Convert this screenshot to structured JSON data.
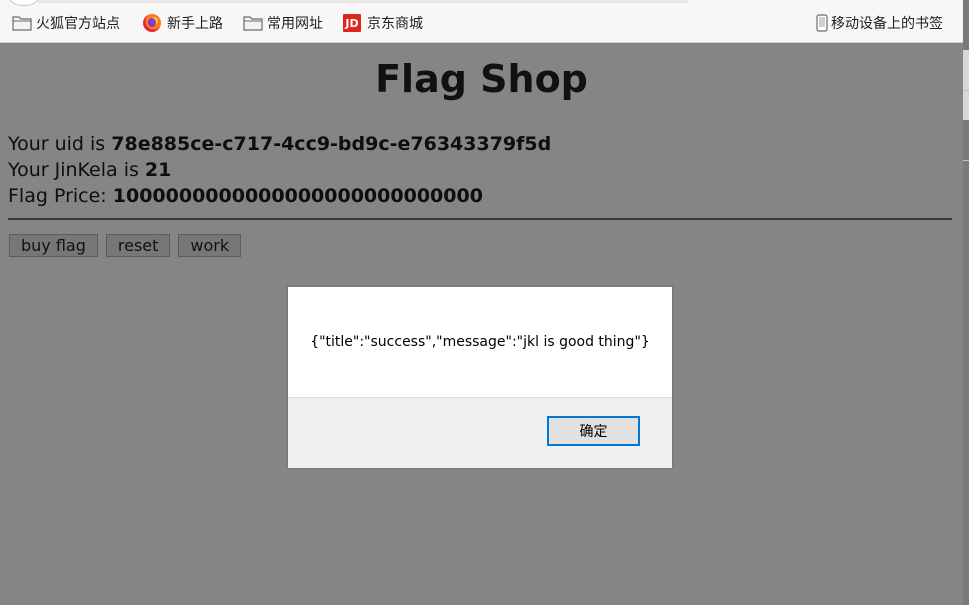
{
  "bookmarks": [
    {
      "label": "火狐官方站点",
      "icon": "folder-icon"
    },
    {
      "label": "新手上路",
      "icon": "firefox-icon"
    },
    {
      "label": "常用网址",
      "icon": "folder-icon"
    },
    {
      "label": "京东商城",
      "icon": "jd-icon",
      "icon_text": "JD"
    }
  ],
  "mobile_bookmarks": {
    "label": "移动设备上的书签",
    "icon": "phone-icon"
  },
  "page": {
    "title": "Flag Shop",
    "uid_label": "Your uid is ",
    "uid_value": "78e885ce-c717-4cc9-bd9c-e76343379f5d",
    "jinkela_label": "Your JinKela is ",
    "jinkela_value": "21",
    "price_label": "Flag Price: ",
    "price_value": "1000000000000000000000000000",
    "buttons": {
      "buy": "buy flag",
      "reset": "reset",
      "work": "work"
    }
  },
  "dialog": {
    "message": "{\"title\":\"success\",\"message\":\"jkl is good thing\"}",
    "ok_label": "确定"
  },
  "colors": {
    "overlay_bg": "#858585",
    "dialog_focus": "#0078d7",
    "jd_red": "#e1251b"
  }
}
